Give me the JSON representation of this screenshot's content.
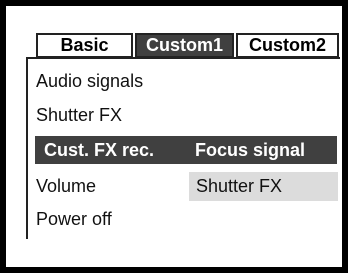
{
  "tabs": [
    {
      "label": "Basic",
      "selected": false
    },
    {
      "label": "Custom1",
      "selected": true
    },
    {
      "label": "Custom2",
      "selected": false
    }
  ],
  "menu": {
    "items": [
      {
        "label": "Audio signals"
      },
      {
        "label": "Shutter FX"
      },
      {
        "label": "Cust. FX rec.",
        "value": "Focus signal",
        "selected": true
      },
      {
        "label": "Volume"
      },
      {
        "label": "Power off"
      }
    ]
  },
  "option": {
    "value": "Shutter FX"
  },
  "colors": {
    "highlight": "#404040",
    "option_bg": "#dcdcdc",
    "border": "#000000",
    "background": "#ffffff"
  }
}
